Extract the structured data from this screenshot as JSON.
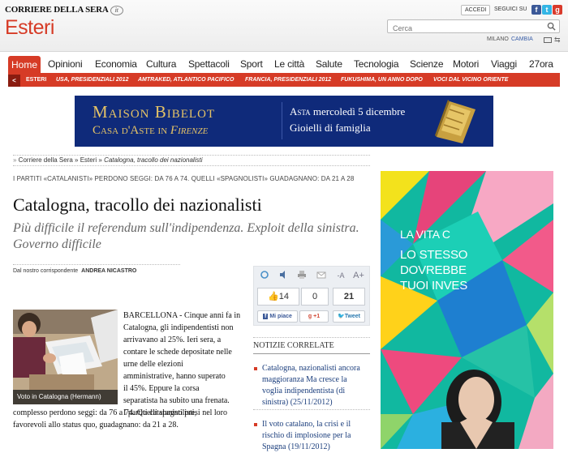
{
  "header": {
    "logo": "CORRIERE DELLA SERA",
    "logo_mark": "it",
    "section": "Esteri",
    "accedi": "ACCEDI",
    "seguici": "SEGUICI SU",
    "search_placeholder": "Cerca",
    "city": "MILANO",
    "change": "CAMBIA"
  },
  "nav": {
    "items": [
      "Home",
      "Opinioni",
      "Economia",
      "Cultura",
      "Spettacoli",
      "Sport",
      "Le città",
      "Salute",
      "Tecnologia",
      "Scienze",
      "Motori",
      "Viaggi",
      "27ora"
    ]
  },
  "subnav": {
    "back": "<",
    "items": [
      "ESTERI",
      "USA, PRESIDENZIALI 2012",
      "AMTRAKED, ATLANTICO PACIFICO",
      "FRANCIA, PRESIDENZIALI 2012",
      "FUKUSHIMA, UN ANNO DOPO",
      "VOCI DAL VICINO ORIENTE"
    ]
  },
  "banner": {
    "title": "Maison Bibelot",
    "sub_a": "Casa d'Aste in ",
    "sub_b": "Firenze",
    "event_a": "Asta",
    "event_b": " mercoledì 5 dicembre",
    "event_line2": "Gioielli di famiglia"
  },
  "breadcrumb": {
    "items": [
      "Corriere della Sera",
      "Esteri"
    ],
    "current": "Catalogna, tracollo dei nazionalisti"
  },
  "article": {
    "kicker": "I PARTITI «CATALANISTI» PERDONO SEGGI: DA 76 A 74. QUELLI «SPAGNOLISTI» GUADAGNANO: DA 21 A 28",
    "headline": "Catalogna, tracollo dei nazionalisti",
    "subhead": "Più difficile il referendum sull'indipendenza. Exploit della sinistra. Governo difficile",
    "correspondent_label": "Dal nostro corrispondente",
    "correspondent_name": "ANDREA NICASTRO",
    "photo_caption": "Voto in Catalogna (Hermann)",
    "lines": [
      "BARCELLONA - Cinque anni fa in",
      "Catalogna, gli indipendentisti non",
      "arrivavano al 25%. Ieri sera, a",
      "contare le schede depositate nelle",
      "urne delle elezioni",
      "amministrative, hanno superato",
      "il 45%. Eppure la corsa",
      "separatista ha subito una frenata.",
      "I partiti catalanisti presi nel loro"
    ],
    "full_lines": [
      "complesso perdono seggi: da 76 a 74. Quelli spagnolisti,",
      "favorevoli allo status quo, guadagnano: da 21 a 28."
    ]
  },
  "share": {
    "likes": "14",
    "tweets_in": "0",
    "count": "21",
    "like_label": "Mi piace",
    "gplus": "+1",
    "tweet_label": "Tweet",
    "font_small": "-A",
    "font_big": "A+"
  },
  "related": {
    "title": "NOTIZIE CORRELATE",
    "items": [
      "Catalogna, nazionalisti ancora maggioranza Ma cresce la voglia indipendentista (di sinistra) (25/11/2012)",
      "Il voto catalano, la crisi e il rischio di implosione per la Spagna (19/11/2012)"
    ],
    "item1_lines": [
      "Catalogna, nazionalisti ancora",
      "maggioranza Ma cresce la",
      "voglia indipendentista (di",
      "sinistra) (25/11/2012)"
    ],
    "item2_lines": [
      "Il voto catalano, la crisi e il",
      "rischio di implosione per la",
      "Spagna (19/11/2012)"
    ]
  },
  "ad": {
    "line1": "LA VITA C",
    "line2": "LO STESSO",
    "line3": "DOVREBBE",
    "line4": "TUOI INVES"
  }
}
